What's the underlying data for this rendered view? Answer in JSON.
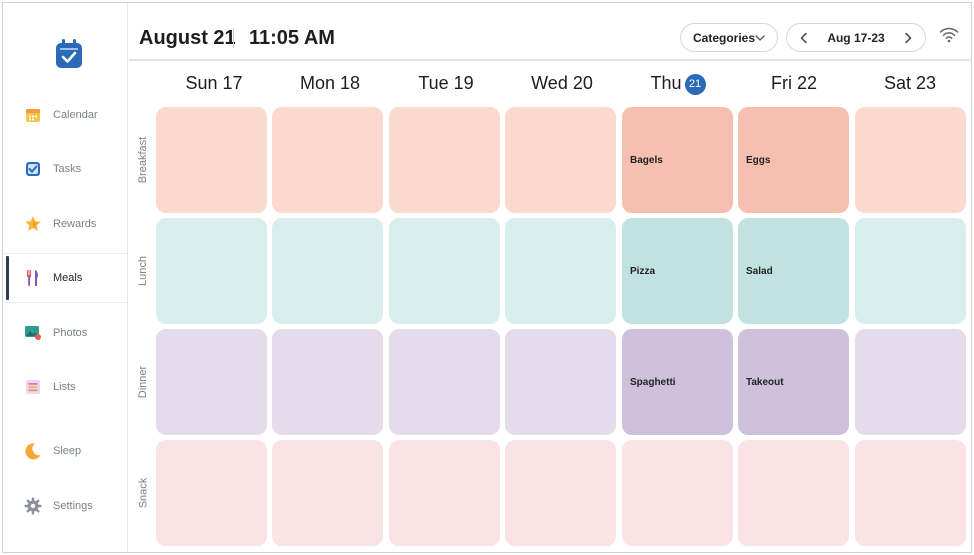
{
  "header": {
    "date": "August 21",
    "time": "11:05 AM",
    "categories_label": "Categories",
    "week_range": "Aug 17-23"
  },
  "sidebar": {
    "items": [
      {
        "label": "Calendar",
        "icon": "calendar-icon"
      },
      {
        "label": "Tasks",
        "icon": "checkbox-icon"
      },
      {
        "label": "Rewards",
        "icon": "star-icon"
      },
      {
        "label": "Meals",
        "icon": "fork-knife-icon",
        "active": true
      },
      {
        "label": "Photos",
        "icon": "photo-icon"
      },
      {
        "label": "Lists",
        "icon": "list-icon"
      },
      {
        "label": "Sleep",
        "icon": "moon-icon"
      },
      {
        "label": "Settings",
        "icon": "gear-icon"
      }
    ]
  },
  "days": [
    {
      "label": "Sun 17"
    },
    {
      "label": "Mon 18"
    },
    {
      "label": "Tue 19"
    },
    {
      "label": "Wed 20"
    },
    {
      "label": "Thu",
      "badge": "21",
      "today": true
    },
    {
      "label": "Fri 22"
    },
    {
      "label": "Sat 23"
    }
  ],
  "rows": [
    {
      "label": "Breakfast",
      "cells": [
        "",
        "",
        "",
        "",
        "Bagels",
        "Eggs",
        ""
      ]
    },
    {
      "label": "Lunch",
      "cells": [
        "",
        "",
        "",
        "",
        "Pizza",
        "Salad",
        ""
      ]
    },
    {
      "label": "Dinner",
      "cells": [
        "",
        "",
        "",
        "",
        "Spaghetti",
        "Takeout",
        ""
      ]
    },
    {
      "label": "Snack",
      "cells": [
        "",
        "",
        "",
        "",
        "",
        "",
        ""
      ]
    }
  ],
  "colors": {
    "accent": "#2a6ab8",
    "breakfast": "#fbd9cf",
    "lunch": "#d8eeec",
    "dinner": "#e6dbea",
    "snack": "#fbe2e5"
  }
}
